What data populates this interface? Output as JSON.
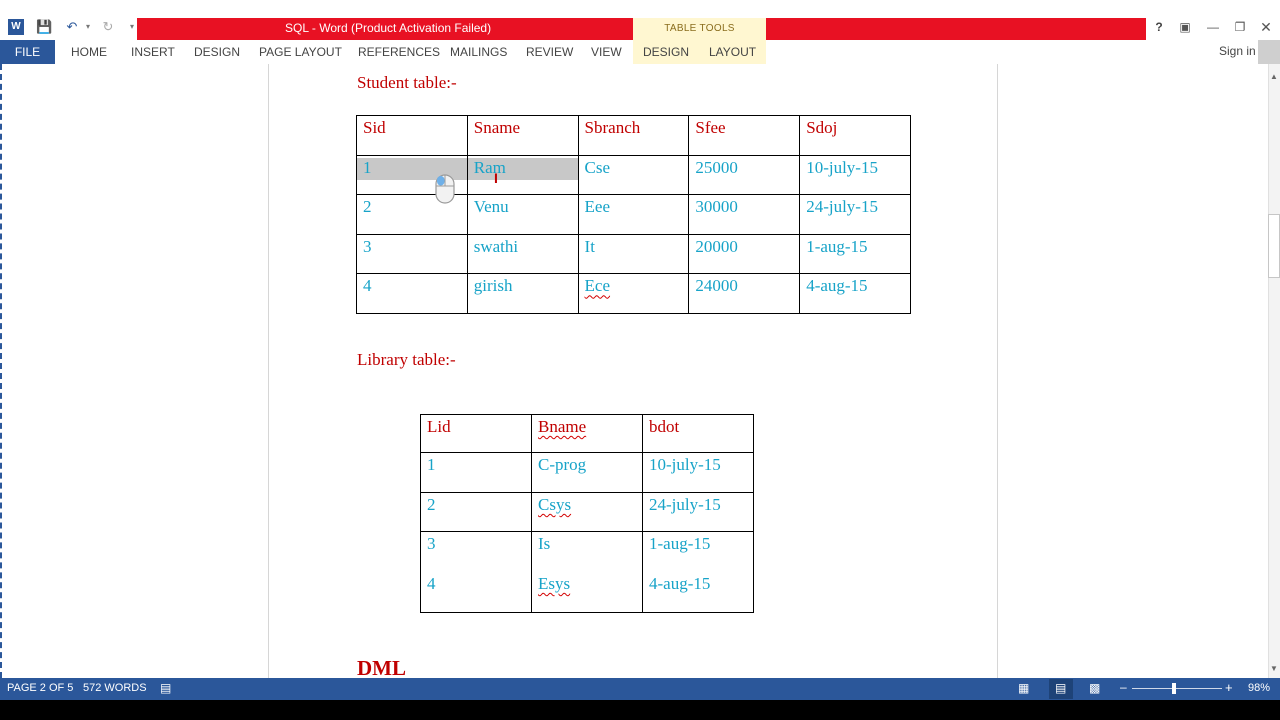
{
  "window": {
    "title": "SQL -  Word (Product Activation Failed)",
    "contextual_group": "TABLE TOOLS",
    "help": "?",
    "sign_in": "Sign in"
  },
  "ribbon": {
    "tabs": [
      "FILE",
      "HOME",
      "INSERT",
      "DESIGN",
      "PAGE LAYOUT",
      "REFERENCES",
      "MAILINGS",
      "REVIEW",
      "VIEW"
    ],
    "table_tools_tabs": [
      "DESIGN",
      "LAYOUT"
    ]
  },
  "document": {
    "student_heading": "Student table:-",
    "library_heading": "Library table:-",
    "dml_heading": "DML",
    "student_table": {
      "headers": [
        "Sid",
        "Sname",
        "Sbranch",
        "Sfee",
        "Sdoj"
      ],
      "rows": [
        [
          "1",
          "Ram",
          "Cse",
          "25000",
          "10-july-15"
        ],
        [
          "2",
          "Venu",
          "Eee",
          "30000",
          "24-july-15"
        ],
        [
          "3",
          "swathi",
          "It",
          "20000",
          "1-aug-15"
        ],
        [
          "4",
          "girish",
          "Ece",
          "24000",
          "4-aug-15"
        ]
      ]
    },
    "library_table": {
      "headers": [
        "Lid",
        "Bname",
        "bdot"
      ],
      "rows": [
        [
          "1",
          "C-prog",
          "10-july-15"
        ],
        [
          "2",
          "Csys",
          "24-july-15"
        ],
        [
          "3",
          "Is",
          "1-aug-15"
        ],
        [
          "4",
          "Esys",
          "4-aug-15"
        ]
      ]
    }
  },
  "status": {
    "page": "PAGE 2 OF 5",
    "words": "572 WORDS",
    "zoom": "98%"
  }
}
